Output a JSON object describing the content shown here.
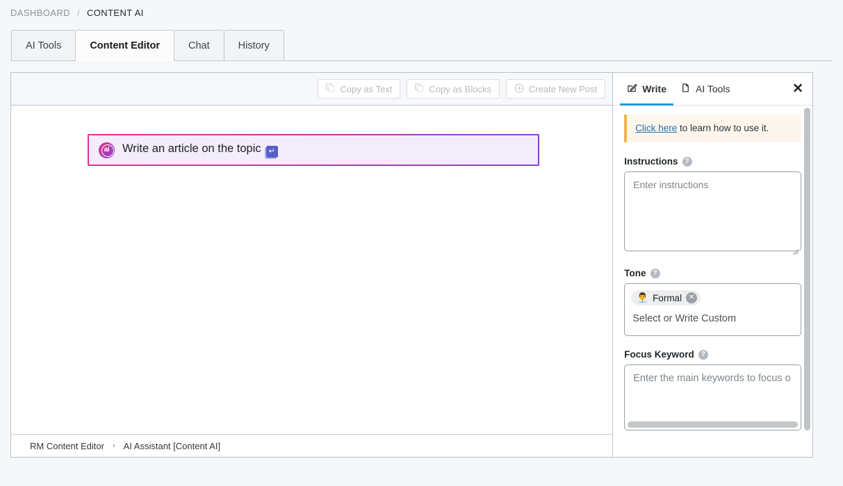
{
  "breadcrumb": {
    "root": "DASHBOARD",
    "separator": "/",
    "current": "CONTENT AI"
  },
  "main_tabs": [
    {
      "label": "AI Tools",
      "active": false
    },
    {
      "label": "Content Editor",
      "active": true
    },
    {
      "label": "Chat",
      "active": false
    },
    {
      "label": "History",
      "active": false
    }
  ],
  "editor": {
    "toolbar": {
      "copy_as_text": "Copy as Text",
      "copy_as_blocks": "Copy as Blocks",
      "create_new_post": "Create New Post",
      "copy_icon": "copy-icon",
      "plus_icon": "plus-circle-icon"
    },
    "block": {
      "badge_text": "ai",
      "text": "Write an article on the topic",
      "enter_key_glyph": "↵",
      "border_gradient_from": "#e0338f",
      "border_gradient_to": "#8b3fd4",
      "background": "#f3ecfa"
    },
    "status_bar": {
      "item1": "RM Content Editor",
      "separator": "›",
      "item2": "AI Assistant [Content AI]"
    }
  },
  "side_panel": {
    "tabs": [
      {
        "label": "Write",
        "icon": "pencil-square-icon",
        "active": true
      },
      {
        "label": "AI Tools",
        "icon": "document-icon",
        "active": false
      }
    ],
    "close_label": "✕",
    "notice": {
      "link_text": "Click here",
      "rest_text": " to learn how to use it.",
      "accent_color": "#efb54b",
      "background": "#fdf6ec"
    },
    "instructions": {
      "label": "Instructions",
      "help_icon": "question-mark-icon",
      "placeholder": "Enter instructions",
      "value": ""
    },
    "tone": {
      "label": "Tone",
      "help_icon": "question-mark-icon",
      "chips": [
        {
          "emoji": "👨‍💼",
          "label": "Formal",
          "remove_glyph": "✕"
        }
      ],
      "placeholder": "Select or Write Custom"
    },
    "focus_keyword": {
      "label": "Focus Keyword",
      "help_icon": "question-mark-icon",
      "placeholder": "Enter the main keywords to focus o",
      "value": ""
    },
    "accent_color": "#2196e3"
  }
}
